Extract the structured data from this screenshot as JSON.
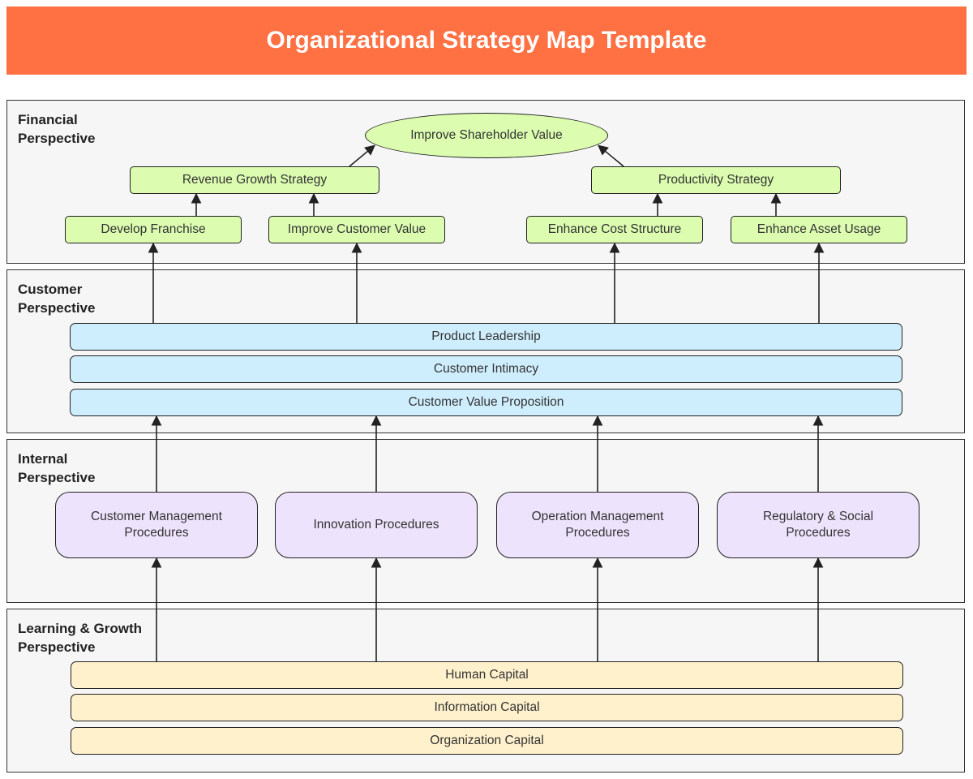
{
  "title": "Organizational Strategy Map Template",
  "colors": {
    "header": "#ff7043",
    "financial_node": "#dcfcb0",
    "customer_node": "#cfeefd",
    "internal_node": "#ede3fc",
    "learning_node": "#fff1cc",
    "lane_background": "#f6f6f6",
    "edge": "#222222"
  },
  "lanes": [
    {
      "id": "financial",
      "label": "Financial Perspective"
    },
    {
      "id": "customer",
      "label": "Customer Perspective"
    },
    {
      "id": "internal",
      "label": "Internal Perspective"
    },
    {
      "id": "learning",
      "label": "Learning & Growth Perspective"
    }
  ],
  "nodes": {
    "shareholder": "Improve Shareholder Value",
    "revenue": "Revenue Growth Strategy",
    "productivity": "Productivity Strategy",
    "franchise": "Develop Franchise",
    "customer_value": "Improve Customer Value",
    "cost": "Enhance Cost Structure",
    "asset": "Enhance Asset Usage",
    "product_leadership": "Product Leadership",
    "customer_intimacy": "Customer Intimacy",
    "value_proposition": "Customer Value Proposition",
    "cust_mgmt": "Customer Management Procedures",
    "innovation": "Innovation Procedures",
    "operation": "Operation Management Procedures",
    "regulatory": "Regulatory & Social Procedures",
    "human": "Human Capital",
    "information": "Information Capital",
    "organization": "Organization Capital"
  },
  "edges": [
    {
      "from": "revenue",
      "to": "shareholder"
    },
    {
      "from": "productivity",
      "to": "shareholder"
    },
    {
      "from": "franchise",
      "to": "revenue"
    },
    {
      "from": "customer_value",
      "to": "revenue"
    },
    {
      "from": "cost",
      "to": "productivity"
    },
    {
      "from": "asset",
      "to": "productivity"
    },
    {
      "from": "product_leadership",
      "to": "franchise"
    },
    {
      "from": "product_leadership",
      "to": "customer_value"
    },
    {
      "from": "product_leadership",
      "to": "cost"
    },
    {
      "from": "product_leadership",
      "to": "asset"
    },
    {
      "from": "cust_mgmt",
      "to": "value_proposition"
    },
    {
      "from": "innovation",
      "to": "value_proposition"
    },
    {
      "from": "operation",
      "to": "value_proposition"
    },
    {
      "from": "regulatory",
      "to": "value_proposition"
    },
    {
      "from": "human",
      "to": "cust_mgmt"
    },
    {
      "from": "human",
      "to": "innovation"
    },
    {
      "from": "human",
      "to": "operation"
    },
    {
      "from": "human",
      "to": "regulatory"
    }
  ]
}
